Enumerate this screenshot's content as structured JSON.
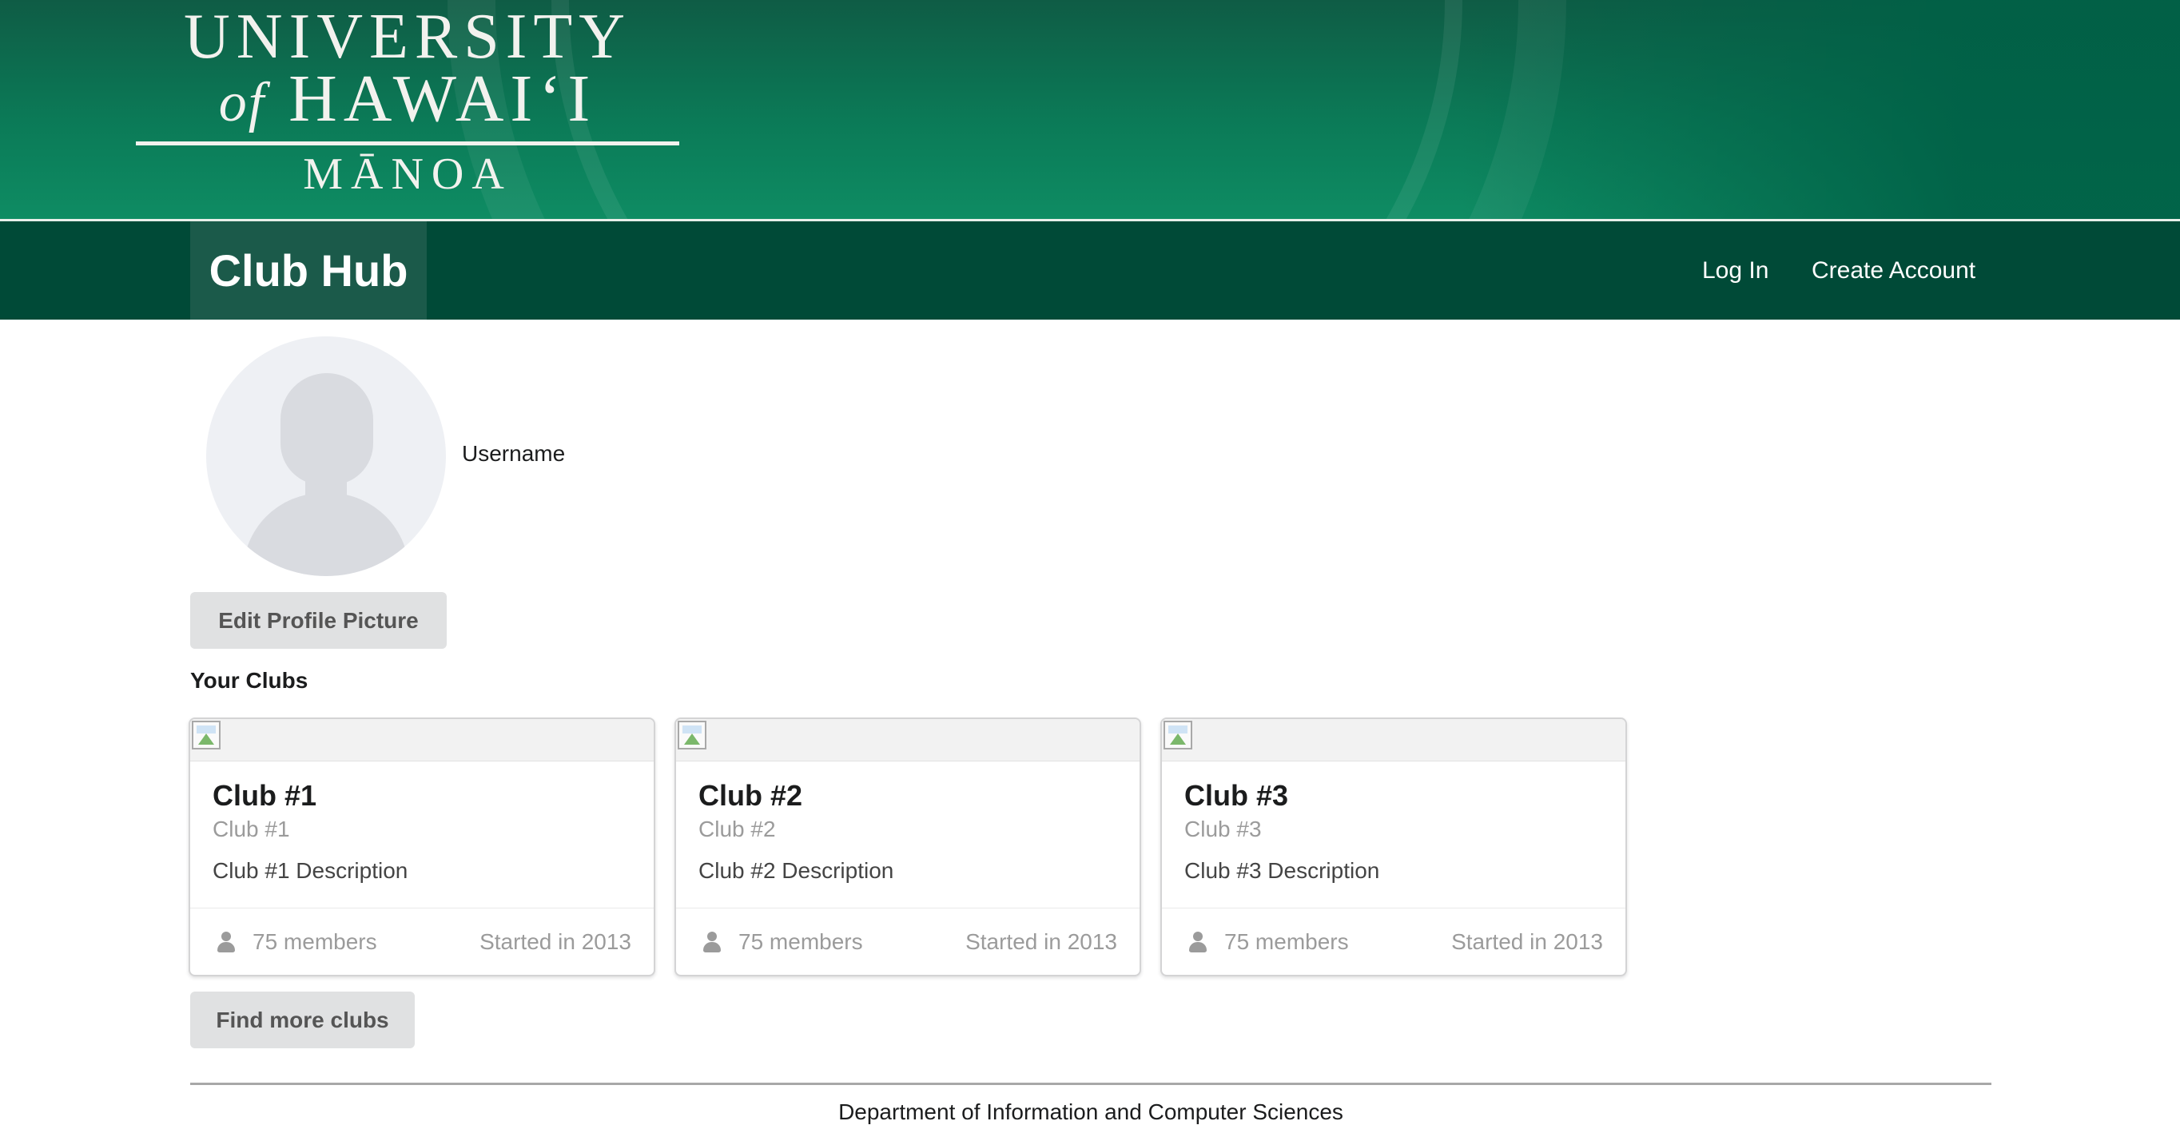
{
  "banner": {
    "logo_line1": "UNIVERSITY",
    "logo_of": "of",
    "logo_line2": "HAWAI‘I",
    "logo_line3": "MĀNOA"
  },
  "navbar": {
    "brand": "Club Hub",
    "login": "Log In",
    "create_account": "Create Account"
  },
  "profile": {
    "username": "Username",
    "edit_picture_button": "Edit Profile Picture"
  },
  "clubs": {
    "heading": "Your Clubs",
    "items": [
      {
        "name": "Club #1",
        "meta": "Club #1",
        "description": "Club #1 Description",
        "members": "75 members",
        "started": "Started in 2013"
      },
      {
        "name": "Club #2",
        "meta": "Club #2",
        "description": "Club #2 Description",
        "members": "75 members",
        "started": "Started in 2013"
      },
      {
        "name": "Club #3",
        "meta": "Club #3",
        "description": "Club #3 Description",
        "members": "75 members",
        "started": "Started in 2013"
      }
    ],
    "find_more_button": "Find more clubs"
  },
  "footer": {
    "text": "Department of Information and Computer Sciences"
  },
  "colors": {
    "nav_bg": "#004a37",
    "brand_bg": "#1b5a4a",
    "banner_green": "#0b7a57",
    "button_bg": "#e0e1e2"
  }
}
